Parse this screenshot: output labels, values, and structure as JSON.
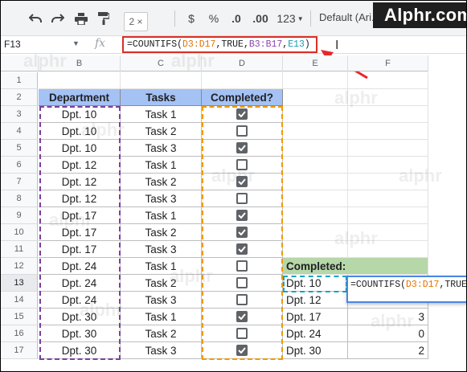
{
  "toolbar": {
    "tooltip": "2 ×",
    "currency": "$",
    "percent": "%",
    "dec_less": ".0",
    "dec_more": ".00",
    "more_formats": "123",
    "font": "Default (Ari..."
  },
  "logo": {
    "text": "Alphr.com"
  },
  "formula_bar": {
    "cell_ref": "F13",
    "fx": "fx",
    "formula_parts": [
      "=COUNTIFS(",
      "D3:D17",
      ",TRUE,",
      "B3:B17",
      ",",
      "E13",
      ")"
    ]
  },
  "columns": [
    "B",
    "C",
    "D",
    "E",
    "F"
  ],
  "rows": [
    "1",
    "2",
    "3",
    "4",
    "5",
    "6",
    "7",
    "8",
    "9",
    "10",
    "11",
    "12",
    "13",
    "14",
    "15",
    "16",
    "17"
  ],
  "table": {
    "headers": [
      "Department",
      "Tasks",
      "Completed?"
    ],
    "rows": [
      {
        "dept": "Dpt. 10",
        "task": "Task 1",
        "done": true
      },
      {
        "dept": "Dpt. 10",
        "task": "Task 2",
        "done": false
      },
      {
        "dept": "Dpt. 10",
        "task": "Task 3",
        "done": true
      },
      {
        "dept": "Dpt. 12",
        "task": "Task 1",
        "done": false
      },
      {
        "dept": "Dpt. 12",
        "task": "Task 2",
        "done": true
      },
      {
        "dept": "Dpt. 12",
        "task": "Task 3",
        "done": false
      },
      {
        "dept": "Dpt. 17",
        "task": "Task 1",
        "done": true
      },
      {
        "dept": "Dpt. 17",
        "task": "Task 2",
        "done": true
      },
      {
        "dept": "Dpt. 17",
        "task": "Task 3",
        "done": true
      },
      {
        "dept": "Dpt. 24",
        "task": "Task 1",
        "done": false
      },
      {
        "dept": "Dpt. 24",
        "task": "Task 2",
        "done": false
      },
      {
        "dept": "Dpt. 24",
        "task": "Task 3",
        "done": false
      },
      {
        "dept": "Dpt. 30",
        "task": "Task 1",
        "done": true
      },
      {
        "dept": "Dpt. 30",
        "task": "Task 2",
        "done": false
      },
      {
        "dept": "Dpt. 30",
        "task": "Task 3",
        "done": true
      }
    ]
  },
  "summary": {
    "header": "Completed:",
    "rows": [
      {
        "dept": "Dpt. 10",
        "count": ""
      },
      {
        "dept": "Dpt. 12",
        "count": ""
      },
      {
        "dept": "Dpt. 17",
        "count": "3"
      },
      {
        "dept": "Dpt. 24",
        "count": "0"
      },
      {
        "dept": "Dpt. 30",
        "count": "2"
      }
    ]
  },
  "popup_formula_parts": [
    "=COUNTIFS(",
    "D3:D17",
    ",TRUE"
  ],
  "watermark": "alphr",
  "colors": {
    "header_blue": "#a4c2f4",
    "summary_green": "#b6d7a8",
    "highlight_red": "#d93025",
    "range_purple": "#7b3fa0",
    "range_orange": "#f29900",
    "range_teal": "#12a4c7"
  }
}
